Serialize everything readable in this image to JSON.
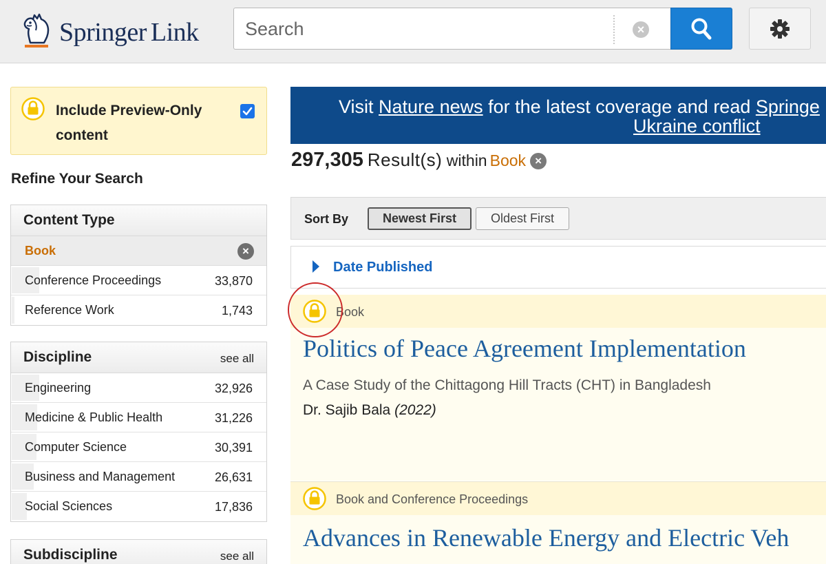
{
  "header": {
    "brand_name": "Springer",
    "brand_suffix": "Link",
    "logo_icon": "springer-horse-icon",
    "search": {
      "placeholder": "Search",
      "value": ""
    },
    "clear_symbol": "×",
    "search_icon": "search-icon",
    "settings_icon": "gear-icon"
  },
  "sidebar": {
    "preview_toggle": {
      "label": "Include Preview-Only content",
      "checked": true,
      "icon": "lock-icon"
    },
    "refine_title": "Refine Your Search",
    "content_type": {
      "title": "Content Type",
      "selected": {
        "label": "Book",
        "remove_symbol": "×"
      },
      "items": [
        {
          "label": "Conference Proceedings",
          "count": "33,870"
        },
        {
          "label": "Reference Work",
          "count": "1,743"
        }
      ]
    },
    "discipline": {
      "title": "Discipline",
      "see_all": "see all",
      "items": [
        {
          "label": "Engineering",
          "count": "32,926"
        },
        {
          "label": "Medicine & Public Health",
          "count": "31,226"
        },
        {
          "label": "Computer Science",
          "count": "30,391"
        },
        {
          "label": "Business and Management",
          "count": "26,631"
        },
        {
          "label": "Social Sciences",
          "count": "17,836"
        }
      ]
    },
    "subdiscipline": {
      "title": "Subdiscipline",
      "see_all": "see all"
    }
  },
  "main": {
    "banner": {
      "prefix": "Visit ",
      "link1": "Nature news",
      "middle": " for the latest coverage and read ",
      "link2": "Springe",
      "line2_link": "Ukraine conflict"
    },
    "results": {
      "count": "297,305",
      "word": "Result(s)",
      "within": "within",
      "scope": "Book",
      "remove_symbol": "×"
    },
    "sort": {
      "label": "Sort By",
      "active": "Newest First",
      "inactive": "Oldest First"
    },
    "date_filter": {
      "label": "Date Published"
    },
    "items": [
      {
        "type": "Book",
        "title": "Politics of Peace Agreement Implementation",
        "subtitle": "A Case Study of the Chittagong Hill Tracts (CHT) in Bangladesh",
        "author": "Dr. Sajib Bala",
        "year": "(2022)"
      },
      {
        "type": "Book and Conference Proceedings",
        "title": "Advances in Renewable Energy and Electric Veh"
      }
    ]
  },
  "colors": {
    "brand_navy": "#1a2e57",
    "accent_orange": "#c96e05",
    "link_blue": "#1d5e9e",
    "search_button": "#1a7fd4",
    "banner_bg": "#0e4a8a",
    "lock_yellow": "#f5c400",
    "highlight_ring": "#cc2b2b"
  }
}
